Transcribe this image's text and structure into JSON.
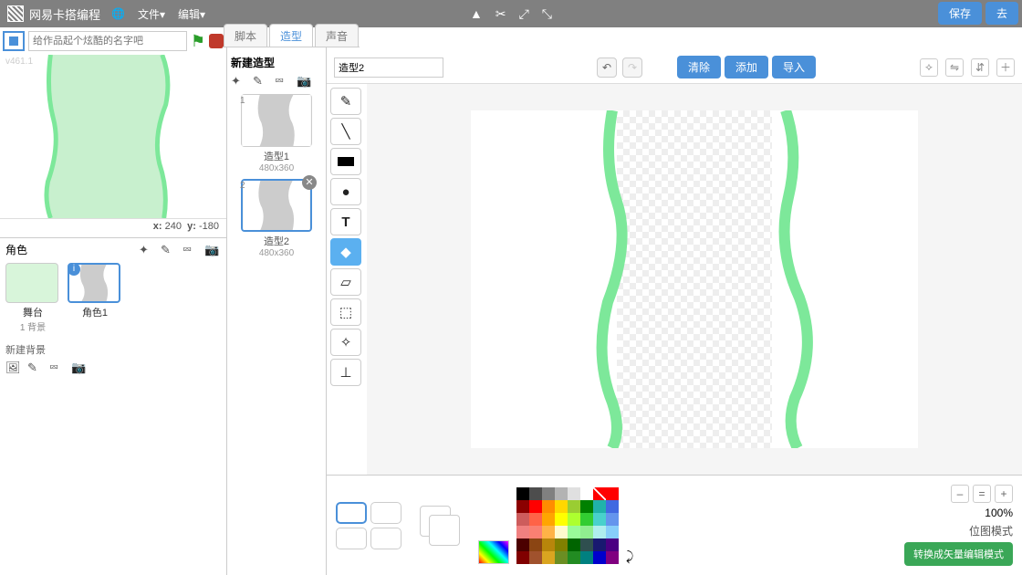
{
  "topbar": {
    "title": "网易卡搭编程",
    "menu_file": "文件",
    "menu_edit": "编辑"
  },
  "header": {
    "placeholder": "给作品起个炫酷的名字吧",
    "version": "v461.1"
  },
  "coords": {
    "x_label": "x:",
    "x": "240",
    "y_label": "y:",
    "y": "-180"
  },
  "sprite_pane": {
    "label": "角色",
    "new_bg": "新建背景",
    "stage_label": "舞台",
    "stage_sub": "1 背景",
    "sprite1": "角色1"
  },
  "tabs": {
    "scripts": "脚本",
    "costumes": "造型",
    "sounds": "声音"
  },
  "mid": {
    "new_costume": "新建造型"
  },
  "costumes": [
    {
      "name": "造型1",
      "dims": "480x360"
    },
    {
      "name": "造型2",
      "dims": "480x360"
    }
  ],
  "editor": {
    "name_value": "造型2",
    "clear": "清除",
    "add": "添加",
    "import": "导入",
    "save": "保存",
    "share": "去",
    "zoom": "100%",
    "mode": "位图模式",
    "convert": "转换成矢量编辑模式"
  },
  "palette": [
    [
      "#000000",
      "#4d4d4d",
      "#808080",
      "#b3b3b3",
      "#e0e0e0",
      "#ffffff",
      "#00000000",
      "#ff0000"
    ],
    [
      "#8b0000",
      "#ff0000",
      "#ff8c00",
      "#ffd700",
      "#9acd32",
      "#008000",
      "#20b2aa",
      "#4169e1"
    ],
    [
      "#cd5c5c",
      "#ff6347",
      "#ffa500",
      "#ffff00",
      "#adff2f",
      "#32cd32",
      "#48d1cc",
      "#6495ed"
    ],
    [
      "#f08080",
      "#fa8072",
      "#ffb347",
      "#fffacd",
      "#98fb98",
      "#90ee90",
      "#afeeee",
      "#87cefa"
    ],
    [
      "#4b0000",
      "#8b4513",
      "#b8860b",
      "#808000",
      "#006400",
      "#2f4f4f",
      "#191970",
      "#4b0082"
    ],
    [
      "#800000",
      "#a0522d",
      "#daa520",
      "#6b8e23",
      "#228b22",
      "#008080",
      "#0000cd",
      "#800080"
    ]
  ]
}
